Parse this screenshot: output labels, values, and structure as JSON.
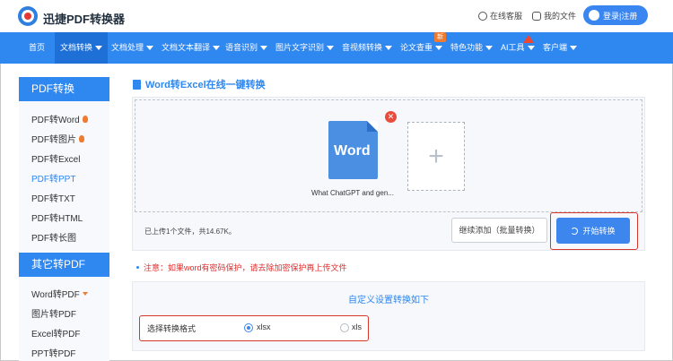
{
  "header": {
    "brand": "迅捷PDF转换器",
    "support": "在线客服",
    "my_files": "我的文件",
    "login": "登录|注册"
  },
  "nav": {
    "items": [
      {
        "label": "首页"
      },
      {
        "label": "文档转换"
      },
      {
        "label": "文档处理"
      },
      {
        "label": "文档文本翻译"
      },
      {
        "label": "语音识别"
      },
      {
        "label": "图片文字识别"
      },
      {
        "label": "音视频转换"
      },
      {
        "label": "论文查重"
      },
      {
        "label": "特色功能"
      },
      {
        "label": "AI工具"
      },
      {
        "label": "客户端"
      }
    ],
    "new_badge": "新"
  },
  "sidebar": {
    "group1_title": "PDF转换",
    "group1_items": [
      {
        "label": "PDF转Word"
      },
      {
        "label": "PDF转图片"
      },
      {
        "label": "PDF转Excel"
      },
      {
        "label": "PDF转PPT"
      },
      {
        "label": "PDF转TXT"
      },
      {
        "label": "PDF转HTML"
      },
      {
        "label": "PDF转长图"
      }
    ],
    "group2_title": "其它转PDF",
    "group2_items": [
      {
        "label": "Word转PDF"
      },
      {
        "label": "图片转PDF"
      },
      {
        "label": "Excel转PDF"
      },
      {
        "label": "PPT转PDF"
      }
    ]
  },
  "main": {
    "title": "Word转Excel在线一键转换",
    "file_icon_text": "Word",
    "file_name": "What ChatGPT and gen...",
    "add_symbol": "+",
    "status": "已上传1个文件，共14.67K。",
    "batch_button": "继续添加（批量转换）",
    "start_button": "开始转换",
    "notice": "注意：如果word有密码保护，请去除加密保护再上传文件",
    "options_title": "自定义设置转换如下",
    "format_label": "选择转换格式",
    "formats": [
      {
        "label": "xlsx",
        "selected": true
      },
      {
        "label": "xls",
        "selected": false
      }
    ]
  },
  "colors": {
    "primary": "#2f87f0",
    "danger": "#d9362b"
  }
}
